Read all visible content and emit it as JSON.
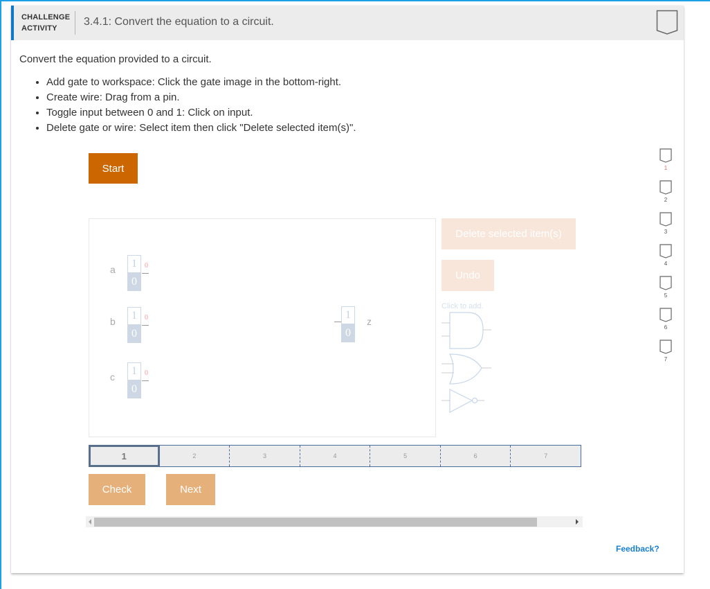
{
  "header": {
    "label_line1": "CHALLENGE",
    "label_line2": "ACTIVITY",
    "title": "3.4.1: Convert the equation to a circuit.",
    "completion_icon": "badge-chevron-icon"
  },
  "intro": "Convert the equation provided to a circuit.",
  "instructions": [
    "Add gate to workspace: Click the gate image in the bottom-right.",
    "Create wire: Drag from a pin.",
    "Toggle input between 0 and 1: Click on input.",
    "Delete gate or wire: Select item then click \"Delete selected item(s)\"."
  ],
  "buttons": {
    "start": "Start",
    "delete": "Delete selected item(s)",
    "undo": "Undo",
    "check": "Check",
    "next": "Next"
  },
  "workspace": {
    "inputs": [
      {
        "name": "a",
        "toggle_top": "1",
        "toggle_bottom": "0",
        "value": "0"
      },
      {
        "name": "b",
        "toggle_top": "1",
        "toggle_bottom": "0",
        "value": "0"
      },
      {
        "name": "c",
        "toggle_top": "1",
        "toggle_bottom": "0",
        "value": "0"
      }
    ],
    "output": {
      "name": "z",
      "toggle_top": "1",
      "toggle_bottom": "0"
    },
    "click_to_add": "Click to add.",
    "gates": [
      "and-gate-icon",
      "or-gate-icon",
      "not-gate-icon"
    ]
  },
  "progress": {
    "steps": [
      "1",
      "2",
      "3",
      "4",
      "5",
      "6",
      "7"
    ],
    "current": 1
  },
  "levels": [
    "1",
    "2",
    "3",
    "4",
    "5",
    "6",
    "7"
  ],
  "feedback": "Feedback?",
  "colors": {
    "accent": "#0e77c7",
    "start": "#cc6600",
    "disabled_button": "#e6b07a",
    "link": "#1a7fcf"
  }
}
